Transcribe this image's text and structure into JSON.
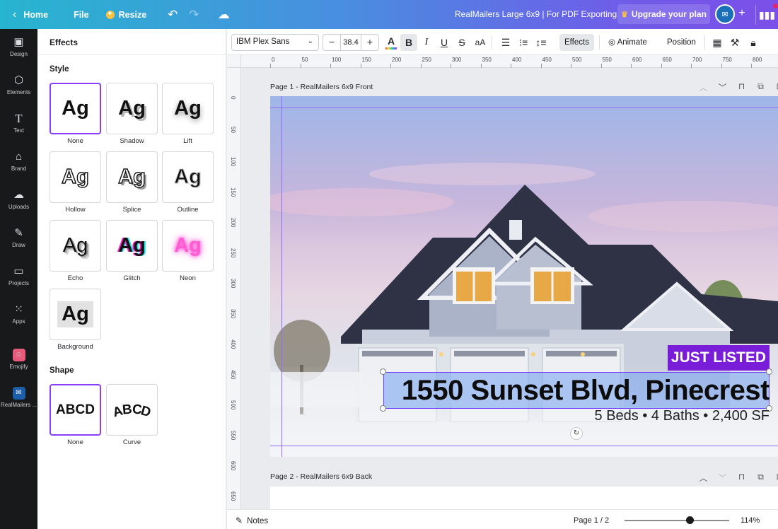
{
  "topbar": {
    "home": "Home",
    "file": "File",
    "resize": "Resize",
    "title": "RealMailers Large 6x9 | For PDF Exporting",
    "upgrade": "Upgrade your plan"
  },
  "rail": [
    {
      "label": "Design",
      "icon": "design-icon"
    },
    {
      "label": "Elements",
      "icon": "elements-icon"
    },
    {
      "label": "Text",
      "icon": "text-icon"
    },
    {
      "label": "Brand",
      "icon": "brand-icon"
    },
    {
      "label": "Uploads",
      "icon": "uploads-icon"
    },
    {
      "label": "Draw",
      "icon": "draw-icon"
    },
    {
      "label": "Projects",
      "icon": "projects-icon"
    },
    {
      "label": "Apps",
      "icon": "apps-icon"
    },
    {
      "label": "Emojify",
      "icon": "emojify-icon"
    },
    {
      "label": "RealMailers ...",
      "icon": "realmailers-icon"
    }
  ],
  "panel": {
    "title": "Effects",
    "style_title": "Style",
    "shape_title": "Shape",
    "sample": "Ag",
    "shape_sample": "ABCD",
    "styles": [
      "None",
      "Shadow",
      "Lift",
      "Hollow",
      "Splice",
      "Outline",
      "Echo",
      "Glitch",
      "Neon",
      "Background"
    ],
    "shapes": [
      "None",
      "Curve"
    ]
  },
  "toolbar": {
    "font": "IBM Plex Sans",
    "size": "38.4",
    "minus": "−",
    "plus": "+",
    "effects": "Effects",
    "animate": "Animate",
    "position": "Position"
  },
  "ruler_h": [
    "0",
    "50",
    "100",
    "150",
    "200",
    "250",
    "300",
    "350",
    "400",
    "450",
    "500",
    "550",
    "600",
    "650",
    "700",
    "750",
    "800"
  ],
  "ruler_v": [
    "0",
    "50",
    "100",
    "150",
    "200",
    "250",
    "300",
    "350",
    "400",
    "450",
    "500",
    "550",
    "600",
    "650"
  ],
  "page1": {
    "label": "Page 1 - RealMailers 6x9 Front",
    "badge": "JUST LISTED",
    "address": "1550 Sunset Blvd, Pinecrest",
    "details": "5 Beds  •  4 Baths  •  2,400 SF"
  },
  "page2": {
    "label": "Page 2 - RealMailers 6x9 Back"
  },
  "bottom": {
    "notes": "Notes",
    "page_count": "Page 1 / 2",
    "zoom": "114%",
    "zoom_level": 0.62
  },
  "colors": {
    "accent": "#8b3dff",
    "badge": "#7a1dd9",
    "rail": "#18191b"
  }
}
